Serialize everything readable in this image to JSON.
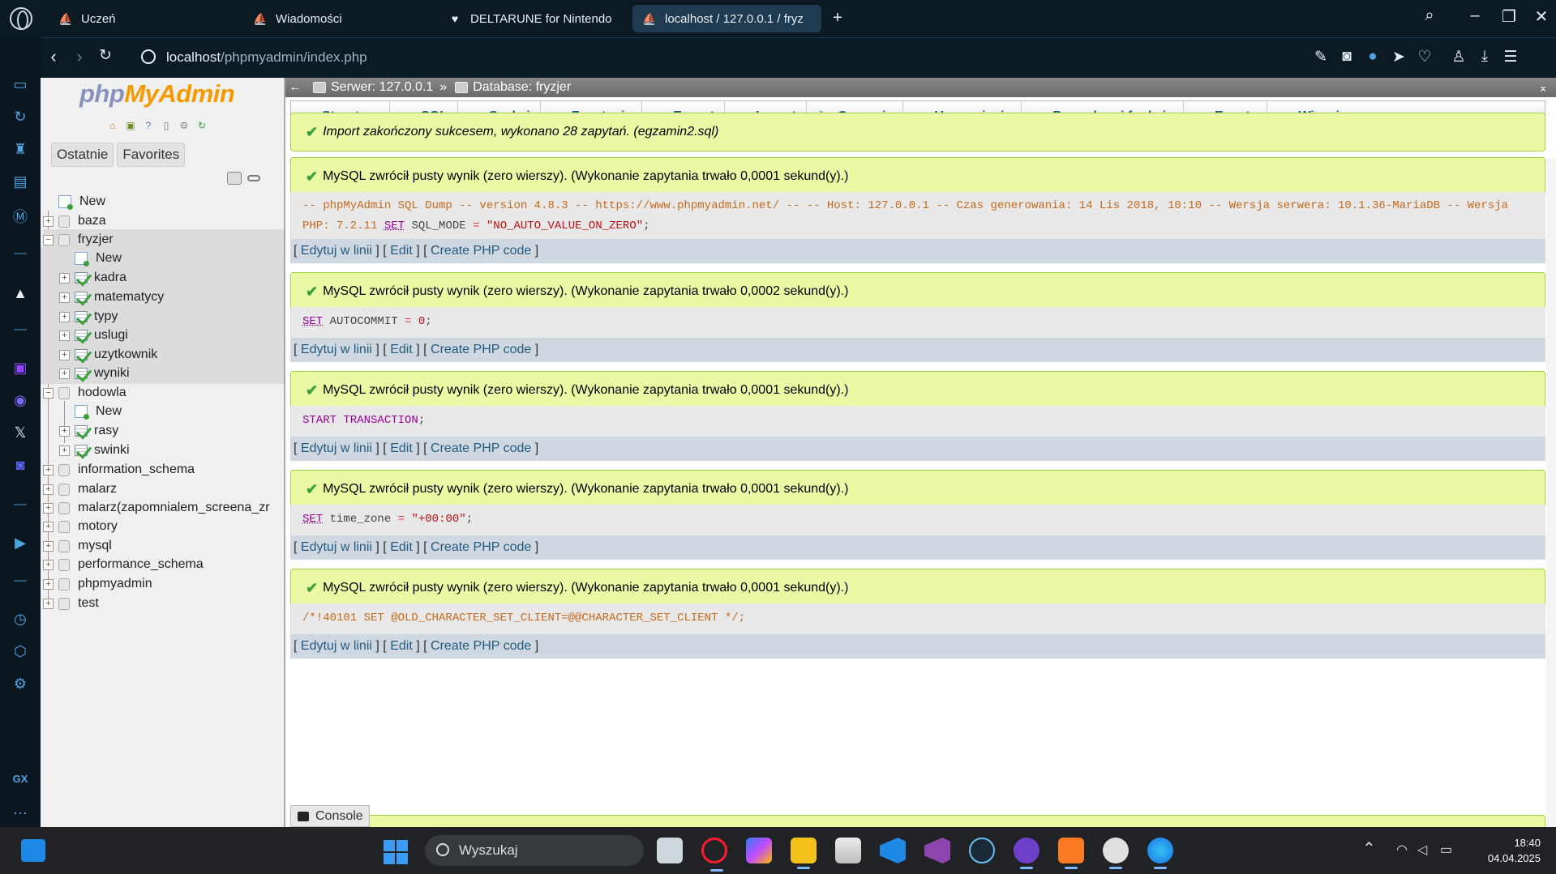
{
  "browser": {
    "tabs": [
      {
        "label": "Uczeń",
        "icon": "phpmyadmin-tab-icon"
      },
      {
        "label": "Wiadomości",
        "icon": "phpmyadmin-tab-icon"
      },
      {
        "label": "DELTARUNE for Nintendo",
        "icon": "deltarune-tab-icon"
      },
      {
        "label": "localhost / 127.0.0.1 / fryz",
        "icon": "phpmyadmin-tab-icon"
      }
    ],
    "new_tab_label": "+",
    "url_host": "localhost",
    "url_path": "/phpmyadmin/index.php"
  },
  "pma": {
    "logo_php": "php",
    "logo_myadmin": "MyAdmin",
    "nav_tabs": [
      "Ostatnie",
      "Favorites"
    ],
    "tree": {
      "new": "New",
      "baza": "baza",
      "fryzjer": "fryzjer",
      "fryzjer_new": "New",
      "fryzjer_tables": [
        "kadra",
        "matematycy",
        "typy",
        "uslugi",
        "uzytkownik",
        "wyniki"
      ],
      "hodowla": "hodowla",
      "hodowla_new": "New",
      "hodowla_tables": [
        "rasy",
        "swinki"
      ],
      "other_dbs": [
        "information_schema",
        "malarz",
        "malarz(zapomnialem_screena_zr",
        "motory",
        "mysql",
        "performance_schema",
        "phpmyadmin",
        "test"
      ]
    },
    "breadcrumb": {
      "server": "Serwer: 127.0.0.1",
      "separator": "»",
      "database": "Database: fryzjer"
    },
    "menu": [
      "Structure",
      "SQL",
      "Szukaj",
      "Zapytanie",
      "Export",
      "Import",
      "Operacje",
      "Uprawnienia",
      "Procedury i funkcje",
      "Events",
      "Więcej"
    ],
    "import_message": "Import zakończony sukcesem, wykonano 28 zapytań. (egzamin2.sql)",
    "results": [
      {
        "message": "MySQL zwrócił pusty wynik (zero wierszy). (Wykonanie zapytania trwało 0,0001 sekund(y).)"
      },
      {
        "message": "MySQL zwrócił pusty wynik (zero wierszy). (Wykonanie zapytania trwało 0,0002 sekund(y).)"
      },
      {
        "message": "MySQL zwrócił pusty wynik (zero wierszy). (Wykonanie zapytania trwało 0,0001 sekund(y).)"
      },
      {
        "message": "MySQL zwrócił pusty wynik (zero wierszy). (Wykonanie zapytania trwało 0,0001 sekund(y).)"
      },
      {
        "message": "MySQL zwrócił pusty wynik (zero wierszy). (Wykonanie zapytania trwało 0,0001 sekund(y).)"
      }
    ],
    "sql": {
      "q1_comment": "-- phpMyAdmin SQL Dump -- version 4.8.3 -- https://www.phpmyadmin.net/ -- -- Host: 127.0.0.1 -- Czas generowania: 14 Lis 2018, 10:10 -- Wersja serwera: 10.1.36-MariaDB -- Wersja PHP: 7.2.11",
      "q1_kw": "SET",
      "q1_rest": "SQL_MODE",
      "q1_op": "=",
      "q1_str": "\"NO_AUTO_VALUE_ON_ZERO\"",
      "q1_end": ";",
      "q2_kw": "SET",
      "q2_rest": "AUTOCOMMIT",
      "q2_op": "=",
      "q2_num": "0",
      "q2_end": ";",
      "q3_kw": "START TRANSACTION",
      "q3_end": ";",
      "q4_kw": "SET",
      "q4_rest": "time_zone",
      "q4_op": "=",
      "q4_str": "\"+00:00\"",
      "q4_end": ";",
      "q5_comment": "/*!40101 SET @OLD_CHARACTER_SET_CLIENT=@@CHARACTER_SET_CLIENT */;"
    },
    "edit_links": {
      "bracket_open": "[",
      "bracket_close": "]",
      "inline": "Edytuj w linii",
      "edit": "Edit",
      "php": "Create PHP code"
    },
    "console_label": "Console"
  },
  "taskbar": {
    "search_placeholder": "Wyszukaj",
    "time": "18:40",
    "date": "04.04.2025"
  },
  "colors": {
    "success_bg": "#ebf8a4",
    "success_border": "#a2d246",
    "link": "#235a81",
    "pma_orange": "#f59a00",
    "pma_purple": "#8892bf"
  }
}
